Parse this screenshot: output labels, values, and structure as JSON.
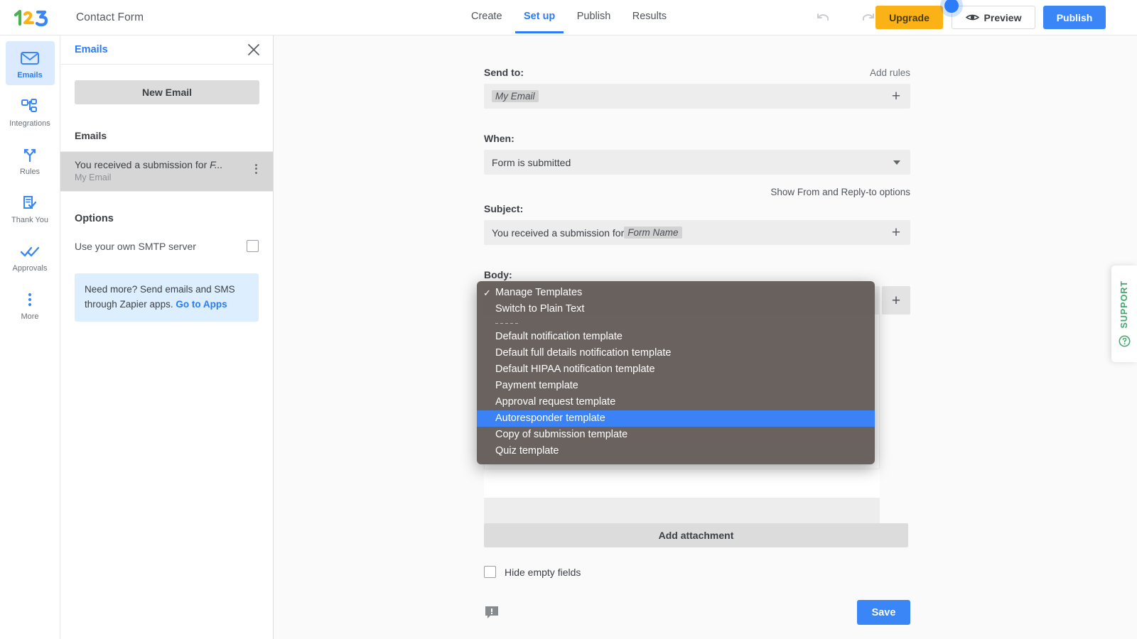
{
  "header": {
    "logo_alt": "123 Form Builder logo",
    "form_title": "Contact Form",
    "nav": [
      {
        "label": "Create",
        "active": false
      },
      {
        "label": "Set up",
        "active": true
      },
      {
        "label": "Publish",
        "active": false
      },
      {
        "label": "Results",
        "active": false
      }
    ],
    "undo_icon": "undo-arrow-icon",
    "redo_icon": "redo-arrow-icon",
    "upgrade_label": "Upgrade",
    "preview_label": "Preview",
    "preview_icon": "eye-icon",
    "publish_label": "Publish",
    "accent_blue": "#3b86f7",
    "upgrade_yellow": "#fbb216"
  },
  "rail": {
    "items": [
      {
        "label": "Emails",
        "icon": "envelope-icon",
        "active": true
      },
      {
        "label": "Integrations",
        "icon": "nodes-icon",
        "active": false
      },
      {
        "label": "Rules",
        "icon": "branch-icon",
        "active": false
      },
      {
        "label": "Thank You",
        "icon": "doc-check-icon",
        "active": false
      },
      {
        "label": "Approvals",
        "icon": "double-check-icon",
        "active": false
      },
      {
        "label": "More",
        "icon": "dots-vertical-icon",
        "active": false
      }
    ]
  },
  "panel": {
    "title": "Emails",
    "close_icon": "close-icon",
    "new_email_label": "New Email",
    "list_heading": "Emails",
    "emails": [
      {
        "title_prefix": "You received a submission for ",
        "title_token": "F...",
        "subtitle": "My Email",
        "menu_icon": "kebab-menu-icon",
        "selected": true
      }
    ],
    "options_heading": "Options",
    "smtp_label": "Use your own SMTP server",
    "smtp_checked": false,
    "zapier_text": "Need more? Send emails and SMS through Zapier apps. ",
    "zapier_link": "Go to Apps"
  },
  "form": {
    "send_to_label": "Send to:",
    "add_rules_label": "Add rules",
    "send_to_token": "My Email",
    "when_label": "When:",
    "when_value": "Form is submitted",
    "show_from_label": "Show From and Reply-to options",
    "subject_label": "Subject:",
    "subject_text": "You received a submission for ",
    "subject_token": "Form Name",
    "body_label": "Body:",
    "plus_icon": "plus-icon",
    "add_attachment_label": "Add attachment",
    "hide_empty_label": "Hide empty fields",
    "hide_empty_checked": false,
    "feedback_icon": "feedback-bubble-icon",
    "save_label": "Save"
  },
  "dropdown": {
    "items": [
      {
        "label": "Manage Templates",
        "checked": true,
        "selected": false,
        "separator": false
      },
      {
        "label": "Switch to Plain Text",
        "checked": false,
        "selected": false,
        "separator": false
      },
      {
        "label": "",
        "checked": false,
        "selected": false,
        "separator": true
      },
      {
        "label": "Default notification template",
        "checked": false,
        "selected": false,
        "separator": false
      },
      {
        "label": "Default full details notification template",
        "checked": false,
        "selected": false,
        "separator": false
      },
      {
        "label": "Default HIPAA notification template",
        "checked": false,
        "selected": false,
        "separator": false
      },
      {
        "label": "Payment template",
        "checked": false,
        "selected": false,
        "separator": false
      },
      {
        "label": "Approval request template",
        "checked": false,
        "selected": false,
        "separator": false
      },
      {
        "label": "Autoresponder template",
        "checked": false,
        "selected": true,
        "separator": false
      },
      {
        "label": "Copy of submission template",
        "checked": false,
        "selected": false,
        "separator": false
      },
      {
        "label": "Quiz template",
        "checked": false,
        "selected": false,
        "separator": false
      }
    ],
    "highlight_color": "#3b82f6"
  },
  "support": {
    "label": "SUPPORT",
    "icon": "question-circle-icon",
    "color": "#3fa86a"
  }
}
